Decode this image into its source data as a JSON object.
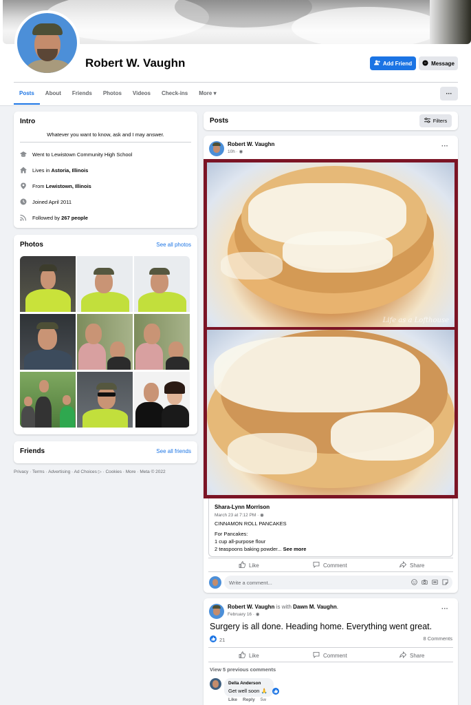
{
  "profile": {
    "name": "Robert W. Vaughn",
    "add_friend": "Add Friend",
    "message": "Message",
    "more_button": "···"
  },
  "tabs": [
    "Posts",
    "About",
    "Friends",
    "Photos",
    "Videos",
    "Check-ins",
    "More ▾"
  ],
  "intro": {
    "title": "Intro",
    "bio": "Whatever you want to know, ask and I may answer.",
    "rows": [
      {
        "icon": "graduation-cap-icon",
        "pre": "Went to Lewistown Community High School",
        "bold": "",
        "post": ""
      },
      {
        "icon": "home-icon",
        "pre": "Lives in ",
        "bold": "Astoria, Illinois",
        "post": ""
      },
      {
        "icon": "location-pin-icon",
        "pre": "From ",
        "bold": "Lewistown, Illinois",
        "post": ""
      },
      {
        "icon": "clock-icon",
        "pre": "Joined April 2011",
        "bold": "",
        "post": ""
      },
      {
        "icon": "rss-icon",
        "pre": "Followed by ",
        "bold": "267 people",
        "post": ""
      }
    ]
  },
  "photos": {
    "title": "Photos",
    "see_all": "See all photos"
  },
  "friends": {
    "title": "Friends",
    "see_all": "See all friends"
  },
  "footer": "Privacy · Terms · Advertising · Ad Choices ▷ · Cookies · More · Meta © 2022",
  "posts_header": {
    "title": "Posts",
    "filters": "Filters"
  },
  "post1": {
    "author": "Robert W. Vaughn",
    "time": "10h · ◉",
    "watermark": "Life as a Lofthouse",
    "shared_author": "Shara-Lynn Morrison",
    "shared_time": "March 23 at 7:12 PM · ◉",
    "shared_title": "CINNAMON ROLL PANCAKES",
    "shared_line1": "For Pancakes:",
    "shared_line2": "1 cup all-purpose flour",
    "shared_line3": "2 teaspoons baking powder...",
    "see_more": "See more",
    "like": "Like",
    "comment": "Comment",
    "share": "Share",
    "write_comment": "Write a comment..."
  },
  "post2": {
    "author": "Robert W. Vaughn",
    "with_text": "is with",
    "tagged": "Dawn M. Vaughn",
    "time": "February 16 · ◉",
    "text": "Surgery is all done. Heading home. Everything went great.",
    "reactions": "21",
    "comments_count": "8 Comments",
    "like": "Like",
    "comment": "Comment",
    "share": "Share",
    "view_previous": "View 5 previous comments",
    "commenter": "Della Anderson",
    "comment_text": "Get well soon 🙏",
    "c_like": "Like",
    "c_reply": "Reply",
    "c_time": "5w"
  },
  "colors": {
    "accent": "#1b74e4",
    "background": "#f0f2f5",
    "card": "#ffffff",
    "image_frame": "#7b1425"
  }
}
